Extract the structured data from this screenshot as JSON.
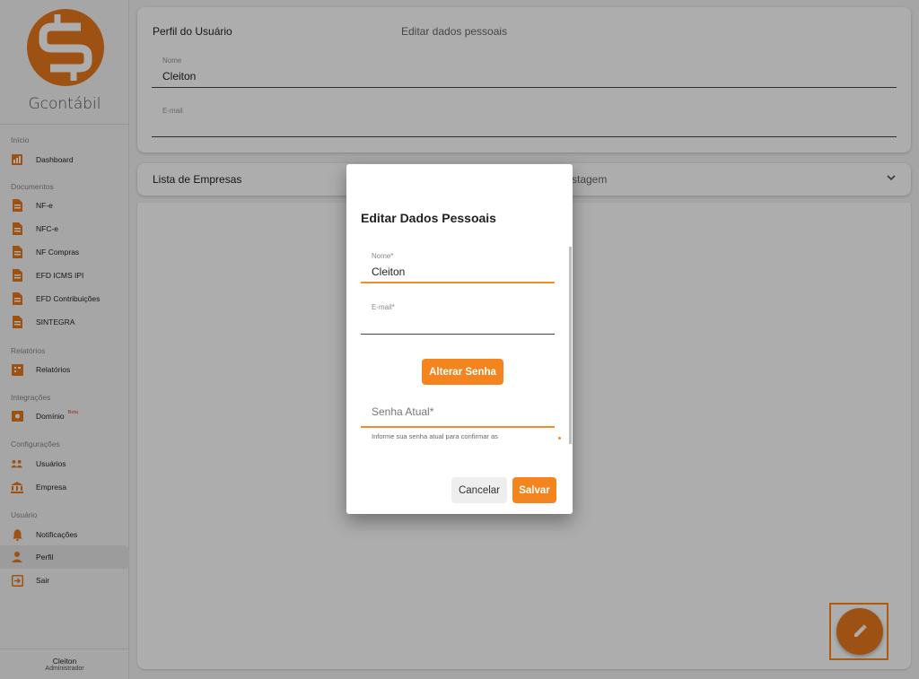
{
  "app": {
    "brand": "Gcontábil",
    "accent_color": "#E87A1D"
  },
  "sidebar": {
    "sections": [
      {
        "title": "Início",
        "items": [
          {
            "label": "Dashboard",
            "icon": "chart-icon"
          }
        ]
      },
      {
        "title": "Documentos",
        "items": [
          {
            "label": "NF-e",
            "icon": "document-icon"
          },
          {
            "label": "NFC-e",
            "icon": "document-icon"
          },
          {
            "label": "NF Compras",
            "icon": "document-icon"
          },
          {
            "label": "EFD ICMS IPI",
            "icon": "document-icon"
          },
          {
            "label": "EFD Contribuições",
            "icon": "document-icon"
          },
          {
            "label": "SINTEGRA",
            "icon": "document-icon"
          }
        ]
      },
      {
        "title": "Relatórios",
        "items": [
          {
            "label": "Relatórios",
            "icon": "report-icon"
          }
        ]
      },
      {
        "title": "Integrações",
        "items": [
          {
            "label": "Domínio",
            "badge": "Beta",
            "icon": "integration-icon"
          }
        ]
      },
      {
        "title": "Configurações",
        "items": [
          {
            "label": "Usuários",
            "icon": "users-icon"
          },
          {
            "label": "Empresa",
            "icon": "bank-icon"
          }
        ]
      },
      {
        "title": "Usuário",
        "items": [
          {
            "label": "Notificações",
            "icon": "bell-icon"
          },
          {
            "label": "Perfil",
            "icon": "person-icon",
            "active": true
          },
          {
            "label": "Sair",
            "icon": "logout-icon"
          }
        ]
      }
    ],
    "user": {
      "name": "Cleiton",
      "role": "Administrador"
    }
  },
  "profile_card": {
    "tabs": [
      "Perfil do Usuário",
      "Editar dados pessoais"
    ],
    "name_label": "Nome",
    "name_value": "Cleiton",
    "email_label": "E-mail",
    "email_value": ""
  },
  "companies_card": {
    "title": "Lista de Empresas",
    "right_text": "stagem"
  },
  "dialog": {
    "title": "Editar Dados Pessoais",
    "name_label": "Nome*",
    "name_value": "Cleiton",
    "email_label": "E-mail*",
    "email_value": "",
    "change_password_label": "Alterar Senha",
    "current_password_placeholder": "Senha Atual*",
    "current_password_hint": "Informe sua senha atual para confirmar as",
    "cancel_label": "Cancelar",
    "save_label": "Salvar"
  },
  "fab": {
    "icon": "pencil-icon"
  }
}
